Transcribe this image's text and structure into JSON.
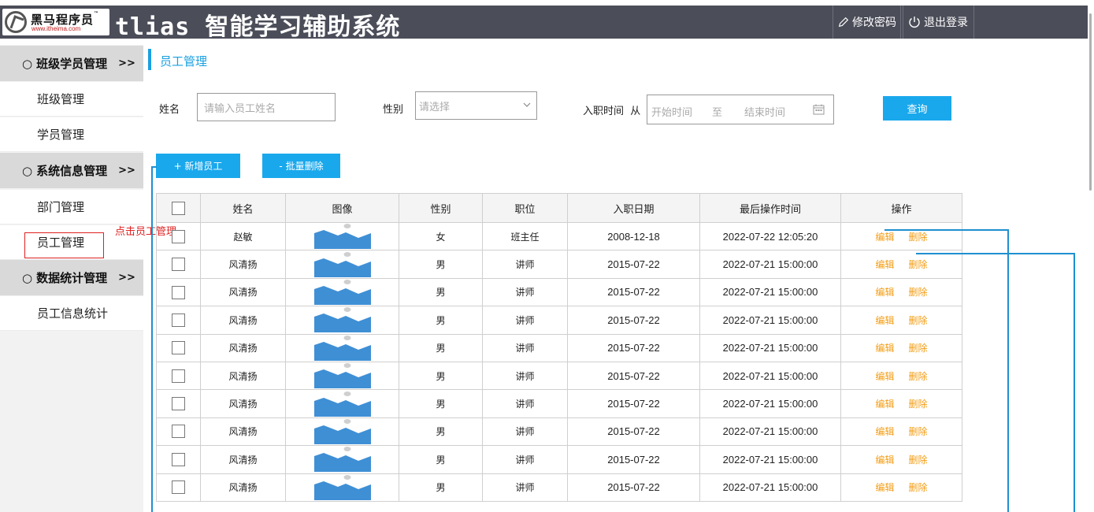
{
  "header": {
    "logo_name": "黑马程序员",
    "logo_tm": "™",
    "logo_url": "www.itheima.com",
    "app_title": "tlias 智能学习辅助系统",
    "change_password_label": "修改密码",
    "logout_label": "退出登录"
  },
  "sidebar": {
    "groups": [
      {
        "label": "班级学员管理",
        "arrow": ">>",
        "items": [
          "班级管理",
          "学员管理"
        ]
      },
      {
        "label": "系统信息管理",
        "arrow": ">>",
        "items": [
          "部门管理",
          "员工管理"
        ]
      },
      {
        "label": "数据统计管理",
        "arrow": ">>",
        "items": [
          "员工信息统计"
        ]
      }
    ],
    "bullet": "○"
  },
  "annotation": "点击员工管理",
  "breadcrumb": "员工管理",
  "search": {
    "name_label": "姓名",
    "name_placeholder": "请输入员工姓名",
    "gender_label": "性别",
    "gender_placeholder": "请选择",
    "date_label": "入职时间",
    "date_from": "从",
    "date_start_placeholder": "开始时间",
    "date_sep": "至",
    "date_end_placeholder": "结束时间",
    "query_label": "查询"
  },
  "actions": {
    "add_label": "+ 新增员工",
    "batch_delete_label": "- 批量删除"
  },
  "table": {
    "headers": [
      "姓名",
      "图像",
      "性别",
      "职位",
      "入职日期",
      "最后操作时间",
      "操作"
    ],
    "edit_label": "编辑",
    "delete_label": "删除",
    "rows": [
      {
        "name": "赵敏",
        "gender": "女",
        "position": "班主任",
        "entry_date": "2008-12-18",
        "update_time": "2022-07-22 12:05:20"
      },
      {
        "name": "风清扬",
        "gender": "男",
        "position": "讲师",
        "entry_date": "2015-07-22",
        "update_time": "2022-07-21 15:00:00"
      },
      {
        "name": "风清扬",
        "gender": "男",
        "position": "讲师",
        "entry_date": "2015-07-22",
        "update_time": "2022-07-21 15:00:00"
      },
      {
        "name": "风清扬",
        "gender": "男",
        "position": "讲师",
        "entry_date": "2015-07-22",
        "update_time": "2022-07-21 15:00:00"
      },
      {
        "name": "风清扬",
        "gender": "男",
        "position": "讲师",
        "entry_date": "2015-07-22",
        "update_time": "2022-07-21 15:00:00"
      },
      {
        "name": "风清扬",
        "gender": "男",
        "position": "讲师",
        "entry_date": "2015-07-22",
        "update_time": "2022-07-21 15:00:00"
      },
      {
        "name": "风清扬",
        "gender": "男",
        "position": "讲师",
        "entry_date": "2015-07-22",
        "update_time": "2022-07-21 15:00:00"
      },
      {
        "name": "风清扬",
        "gender": "男",
        "position": "讲师",
        "entry_date": "2015-07-22",
        "update_time": "2022-07-21 15:00:00"
      },
      {
        "name": "风清扬",
        "gender": "男",
        "position": "讲师",
        "entry_date": "2015-07-22",
        "update_time": "2022-07-21 15:00:00"
      },
      {
        "name": "风清扬",
        "gender": "男",
        "position": "讲师",
        "entry_date": "2015-07-22",
        "update_time": "2022-07-21 15:00:00"
      }
    ]
  },
  "colors": {
    "accent": "#1aa8ec",
    "header_bg": "#4b4d59",
    "operation": "#f39c12",
    "annotation": "#e02020"
  }
}
